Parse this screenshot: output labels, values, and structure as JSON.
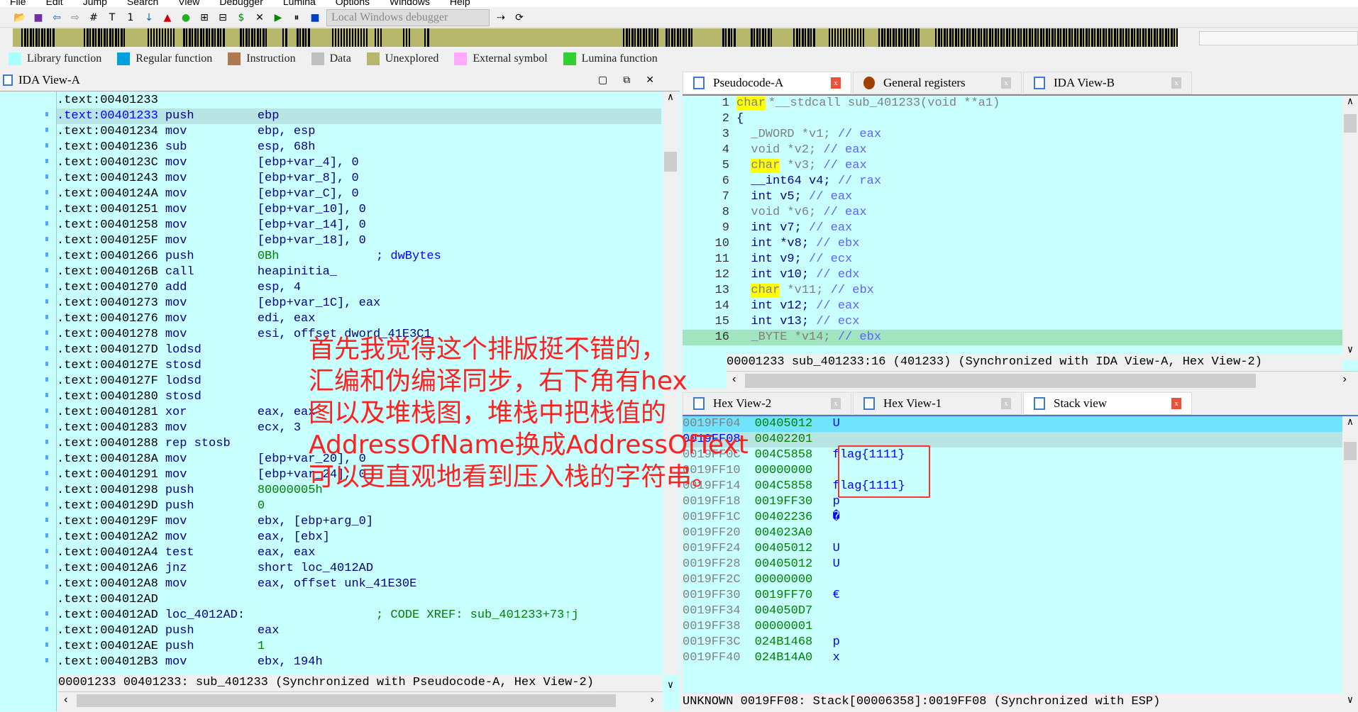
{
  "menu": [
    "File",
    "Edit",
    "Jump",
    "Search",
    "View",
    "Debugger",
    "Lumina",
    "Options",
    "Windows",
    "Help"
  ],
  "toolbar": {
    "debugger_select": "Local Windows debugger"
  },
  "legend": [
    {
      "label": "Library function",
      "color": "#aaffff"
    },
    {
      "label": "Regular function",
      "color": "#00a0e0"
    },
    {
      "label": "Instruction",
      "color": "#b07850"
    },
    {
      "label": "Data",
      "color": "#c0c0c0"
    },
    {
      "label": "Unexplored",
      "color": "#b7b76b"
    },
    {
      "label": "External symbol",
      "color": "#ffa8ff"
    },
    {
      "label": "Lumina function",
      "color": "#30d030"
    }
  ],
  "ida_view_a": {
    "title": "IDA View-A",
    "lines": [
      [
        ".text:00401233",
        "",
        "",
        ""
      ],
      [
        ".text:00401233",
        "push",
        "ebp",
        ""
      ],
      [
        ".text:00401234",
        "mov",
        "ebp, esp",
        ""
      ],
      [
        ".text:00401236",
        "sub",
        "esp, 68h",
        ""
      ],
      [
        ".text:0040123C",
        "mov",
        "[ebp+var_4], 0",
        ""
      ],
      [
        ".text:00401243",
        "mov",
        "[ebp+var_8], 0",
        ""
      ],
      [
        ".text:0040124A",
        "mov",
        "[ebp+var_C], 0",
        ""
      ],
      [
        ".text:00401251",
        "mov",
        "[ebp+var_10], 0",
        ""
      ],
      [
        ".text:00401258",
        "mov",
        "[ebp+var_14], 0",
        ""
      ],
      [
        ".text:0040125F",
        "mov",
        "[ebp+var_18], 0",
        ""
      ],
      [
        ".text:00401266",
        "push",
        "0Bh",
        "; dwBytes"
      ],
      [
        ".text:0040126B",
        "call",
        "heapinitia_",
        ""
      ],
      [
        ".text:00401270",
        "add",
        "esp, 4",
        ""
      ],
      [
        ".text:00401273",
        "mov",
        "[ebp+var_1C], eax",
        ""
      ],
      [
        ".text:00401276",
        "mov",
        "edi, eax",
        ""
      ],
      [
        ".text:00401278",
        "mov",
        "esi, offset dword_41E3C1",
        ""
      ],
      [
        ".text:0040127D",
        "lodsd",
        "",
        ""
      ],
      [
        ".text:0040127E",
        "stosd",
        "",
        ""
      ],
      [
        ".text:0040127F",
        "lodsd",
        "",
        ""
      ],
      [
        ".text:00401280",
        "stosd",
        "",
        ""
      ],
      [
        ".text:00401281",
        "xor",
        "eax, eax",
        ""
      ],
      [
        ".text:00401283",
        "mov",
        "ecx, 3",
        ""
      ],
      [
        ".text:00401288",
        "rep stosb",
        "",
        ""
      ],
      [
        ".text:0040128A",
        "mov",
        "[ebp+var_20], 0",
        ""
      ],
      [
        ".text:00401291",
        "mov",
        "[ebp+var_24], 0",
        ""
      ],
      [
        ".text:00401298",
        "push",
        "80000005h",
        ""
      ],
      [
        ".text:0040129D",
        "push",
        "0",
        ""
      ],
      [
        ".text:0040129F",
        "mov",
        "ebx, [ebp+arg_0]",
        ""
      ],
      [
        ".text:004012A2",
        "mov",
        "eax, [ebx]",
        ""
      ],
      [
        ".text:004012A4",
        "test",
        "eax, eax",
        ""
      ],
      [
        ".text:004012A6",
        "jnz",
        "short loc_4012AD",
        ""
      ],
      [
        ".text:004012A8",
        "mov",
        "eax, offset unk_41E30E",
        ""
      ],
      [
        ".text:004012AD",
        "",
        "",
        ""
      ],
      [
        ".text:004012AD",
        "loc_4012AD:",
        "",
        "; CODE XREF: sub_401233+73↑j"
      ],
      [
        ".text:004012AD",
        "push",
        "eax",
        ""
      ],
      [
        ".text:004012AE",
        "push",
        "1",
        ""
      ],
      [
        ".text:004012B3",
        "mov",
        "ebx, 194h",
        ""
      ]
    ],
    "status": [
      "00001233",
      "00401233: sub_401233",
      "(Synchronized with Pseudocode-A, Hex View-2)"
    ]
  },
  "top_tabs": [
    "Pseudocode-A",
    "General registers",
    "IDA View-B"
  ],
  "pseudocode": {
    "lines": [
      [
        "1",
        "char",
        "*__stdcall sub_401233(void **a1)",
        ""
      ],
      [
        "2",
        "",
        "{",
        ""
      ],
      [
        "3",
        "",
        "  _DWORD *v1; ",
        "// eax"
      ],
      [
        "4",
        "",
        "  void *v2; ",
        "// eax"
      ],
      [
        "5",
        "char",
        "*v3; ",
        "// eax"
      ],
      [
        "6",
        "",
        "  __int64 v4; ",
        "// rax"
      ],
      [
        "7",
        "",
        "  int v5; ",
        "// eax"
      ],
      [
        "8",
        "",
        "  void *v6; ",
        "// eax"
      ],
      [
        "9",
        "",
        "  int v7; ",
        "// eax"
      ],
      [
        "10",
        "",
        "  int *v8; ",
        "// ebx"
      ],
      [
        "11",
        "",
        "  int v9; ",
        "// ecx"
      ],
      [
        "12",
        "",
        "  int v10; ",
        "// edx"
      ],
      [
        "13",
        "char",
        "*v11; ",
        "// ebx"
      ],
      [
        "14",
        "",
        "  int v12; ",
        "// eax"
      ],
      [
        "15",
        "",
        "  int v13; ",
        "// ecx"
      ],
      [
        "16",
        "",
        "  _BYTE *v14; ",
        "// ebx"
      ]
    ],
    "status": [
      "00001233",
      "sub_401233:16 (401233)",
      "(Synchronized with IDA View-A, Hex View-2)"
    ]
  },
  "bottom_tabs": [
    "Hex View-2",
    "Hex View-1",
    "Stack view"
  ],
  "stack": {
    "rows": [
      [
        "0019FF04",
        "00405012",
        "U"
      ],
      [
        "0019FF08",
        "00402201",
        ""
      ],
      [
        "0019FF0C",
        "004C5858",
        "flag{1111}"
      ],
      [
        "0019FF10",
        "00000000",
        ""
      ],
      [
        "0019FF14",
        "004C5858",
        "flag{1111}"
      ],
      [
        "0019FF18",
        "0019FF30",
        "p"
      ],
      [
        "0019FF1C",
        "00402236",
        "�"
      ],
      [
        "0019FF20",
        "004023A0",
        ""
      ],
      [
        "0019FF24",
        "00405012",
        "U"
      ],
      [
        "0019FF28",
        "00405012",
        "U"
      ],
      [
        "0019FF2C",
        "00000000",
        ""
      ],
      [
        "0019FF30",
        "0019FF70",
        "€"
      ],
      [
        "0019FF34",
        "004050D7",
        ""
      ],
      [
        "0019FF38",
        "00000001",
        ""
      ],
      [
        "0019FF3C",
        "024B1468",
        "p"
      ],
      [
        "0019FF40",
        "024B14A0",
        "x"
      ]
    ],
    "status": [
      "UNKNOWN",
      "0019FF08: Stack[00006358]:0019FF08",
      "(Synchronized with ESP)"
    ]
  },
  "annotation": [
    "首先我觉得这个排版挺不错的，",
    "汇编和伪编译同步，右下角有hex",
    "图以及堆栈图，堆栈中把栈值的",
    "AddressOfName换成AddressOfText",
    "可以更直观地看到压入栈的字符串。"
  ]
}
